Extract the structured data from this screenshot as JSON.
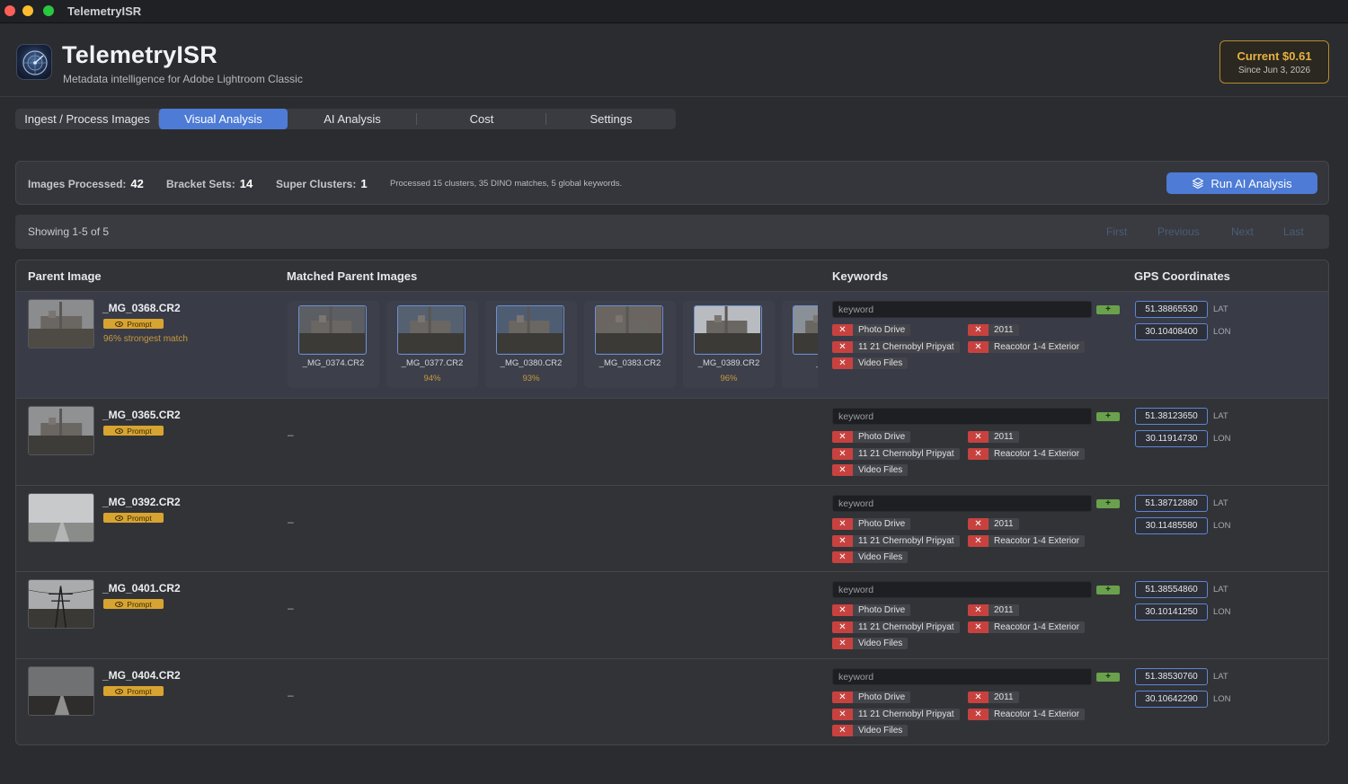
{
  "window": {
    "title": "TelemetryISR"
  },
  "header": {
    "title": "TelemetryISR",
    "subtitle": "Metadata intelligence for Adobe Lightroom Classic",
    "cost_label": "Current $0.61",
    "cost_since": "Since Jun 3, 2026"
  },
  "tabs": [
    {
      "label": "Ingest / Process Images",
      "active": false
    },
    {
      "label": "Visual Analysis",
      "active": true
    },
    {
      "label": "AI Analysis",
      "active": false
    },
    {
      "label": "Cost",
      "active": false
    },
    {
      "label": "Settings",
      "active": false
    }
  ],
  "stats": {
    "images_label": "Images Processed:",
    "images_value": "42",
    "bracket_label": "Bracket Sets:",
    "bracket_value": "14",
    "super_label": "Super Clusters:",
    "super_value": "1",
    "message": "Processed 15 clusters, 35 DINO matches, 5 global keywords.",
    "run_button": "Run AI Analysis"
  },
  "pager": {
    "showing": "Showing 1-5 of 5",
    "first": "First",
    "previous": "Previous",
    "next": "Next",
    "last": "Last"
  },
  "table": {
    "headers": {
      "parent": "Parent Image",
      "matched": "Matched Parent Images",
      "keywords": "Keywords",
      "gps": "GPS Coordinates"
    },
    "keyword_placeholder": "keyword",
    "add_label": "+",
    "remove_label": "✕",
    "prompt_label": "Prompt",
    "lat_label": "LAT",
    "lon_label": "LON",
    "empty_matches": "–",
    "rows": [
      {
        "file": "_MG_0368.CR2",
        "strongest": "96% strongest match",
        "matches": [
          {
            "file": "_MG_0374.CR2",
            "score": ""
          },
          {
            "file": "_MG_0377.CR2",
            "score": "94%"
          },
          {
            "file": "_MG_0380.CR2",
            "score": "93%"
          },
          {
            "file": "_MG_0383.CR2",
            "score": ""
          },
          {
            "file": "_MG_0389.CR2",
            "score": "96%"
          },
          {
            "file": "_MG_",
            "score": ""
          }
        ],
        "keywords": [
          "Photo Drive",
          "2011",
          "11 21 Chernobyl Pripyat",
          "Reacotor 1-4 Exterior",
          "Video Files"
        ],
        "lat": "51.38865530",
        "lon": "30.10408400"
      },
      {
        "file": "_MG_0365.CR2",
        "strongest": "",
        "matches": [],
        "keywords": [
          "Photo Drive",
          "2011",
          "11 21 Chernobyl Pripyat",
          "Reacotor 1-4 Exterior",
          "Video Files"
        ],
        "lat": "51.38123650",
        "lon": "30.11914730"
      },
      {
        "file": "_MG_0392.CR2",
        "strongest": "",
        "matches": [],
        "keywords": [
          "Photo Drive",
          "2011",
          "11 21 Chernobyl Pripyat",
          "Reacotor 1-4 Exterior",
          "Video Files"
        ],
        "lat": "51.38712880",
        "lon": "30.11485580"
      },
      {
        "file": "_MG_0401.CR2",
        "strongest": "",
        "matches": [],
        "keywords": [
          "Photo Drive",
          "2011",
          "11 21 Chernobyl Pripyat",
          "Reacotor 1-4 Exterior",
          "Video Files"
        ],
        "lat": "51.38554860",
        "lon": "30.10141250"
      },
      {
        "file": "_MG_0404.CR2",
        "strongest": "",
        "matches": [],
        "keywords": [
          "Photo Drive",
          "2011",
          "11 21 Chernobyl Pripyat",
          "Reacotor 1-4 Exterior",
          "Video Files"
        ],
        "lat": "51.38530760",
        "lon": "30.10642290"
      }
    ]
  }
}
